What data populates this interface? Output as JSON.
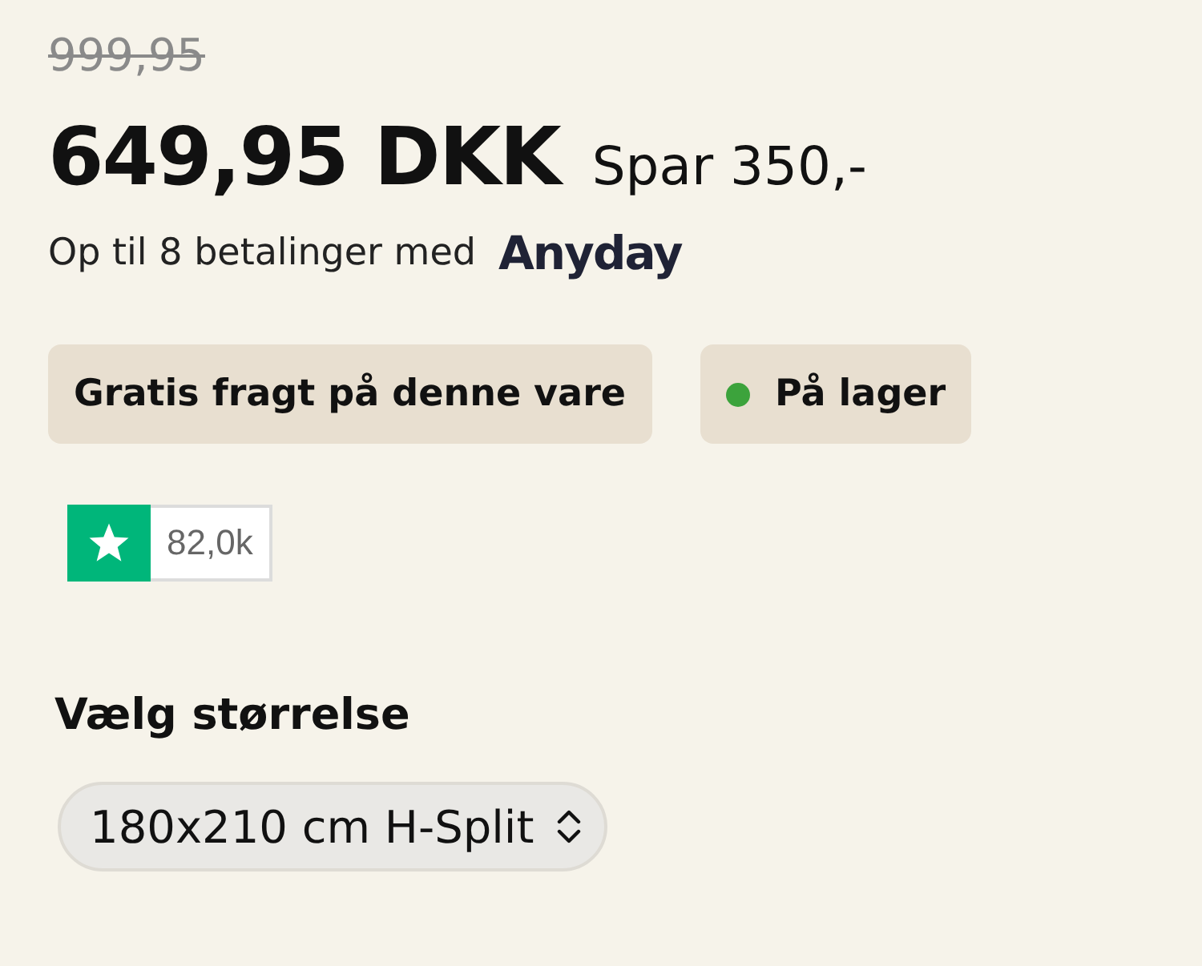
{
  "old_price": "999,95",
  "price": "649,95 DKK",
  "savings": "Spar 350,-",
  "installments": {
    "text": "Op til 8 betalinger med",
    "provider": "Anyday"
  },
  "badges": [
    {
      "kind": "plain",
      "label": "Gratis fragt på denne vare"
    },
    {
      "kind": "status",
      "label": "På lager",
      "color": "#3ca33c"
    }
  ],
  "rating": {
    "count": "82,0k"
  },
  "size": {
    "label": "Vælg størrelse",
    "value": "180x210 cm H-Split"
  }
}
